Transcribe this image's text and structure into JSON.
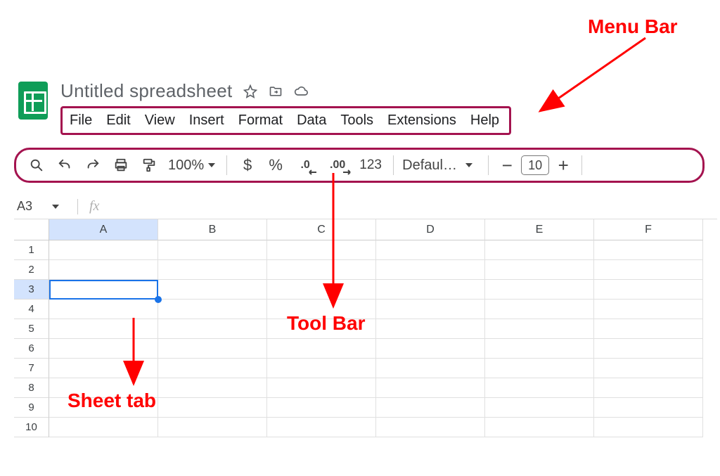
{
  "annotations": {
    "menubar_label": "Menu Bar",
    "toolbar_label": "Tool Bar",
    "sheettab_label": "Sheet tab"
  },
  "title": {
    "name": "Untitled spreadsheet"
  },
  "menubar": {
    "items": [
      "File",
      "Edit",
      "View",
      "Insert",
      "Format",
      "Data",
      "Tools",
      "Extensions",
      "Help"
    ]
  },
  "toolbar": {
    "zoom": "100%",
    "currency": "$",
    "percent": "%",
    "dec_dec": ".0",
    "inc_dec": ".00",
    "more_fmt": "123",
    "font": "Defaul…",
    "font_size": "10"
  },
  "namebox": {
    "cell": "A3",
    "fx": "fx"
  },
  "grid": {
    "columns": [
      "A",
      "B",
      "C",
      "D",
      "E",
      "F"
    ],
    "rows": [
      "1",
      "2",
      "3",
      "4",
      "5",
      "6",
      "7",
      "8",
      "9",
      "10"
    ],
    "selected_col": "A",
    "selected_row": "3"
  }
}
